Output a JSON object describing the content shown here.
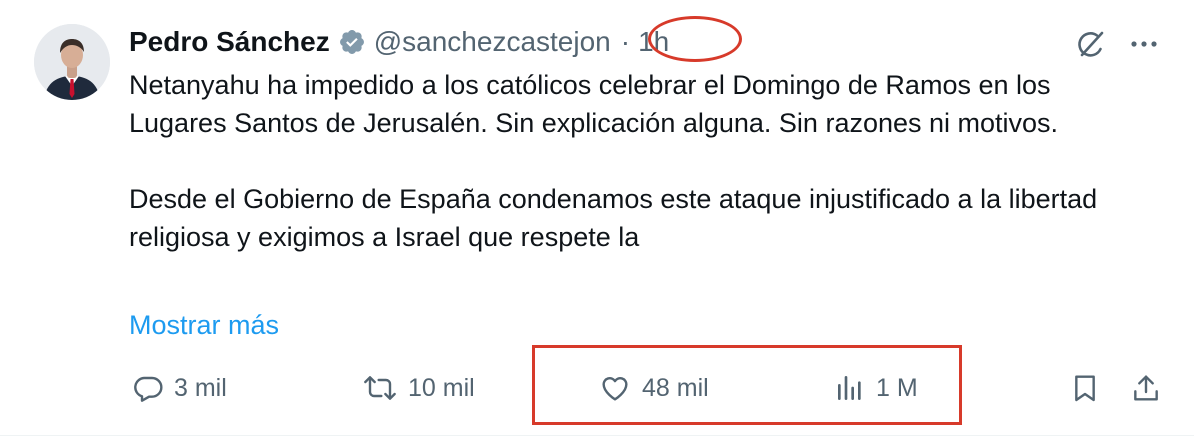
{
  "author": {
    "name": "Pedro Sánchez",
    "handle": "@sanchezcastejon",
    "separator": "·",
    "time": "1h"
  },
  "post": {
    "paragraphs": [
      "Netanyahu ha impedido a los católicos celebrar el Domingo de Ramos en los Lugares Santos de Jerusalén. Sin explicación alguna. Sin razones ni motivos.",
      "Desde el Gobierno de España condenamos este ataque injustificado a la libertad religiosa y exigimos a Israel que respete la"
    ],
    "show_more_label": "Mostrar más"
  },
  "actions": {
    "replies": "3 mil",
    "reposts": "10 mil",
    "likes": "48 mil",
    "views": "1 M"
  },
  "icons": {
    "verified": "verified-badge-icon",
    "grok": "grok-icon",
    "more": "more-icon",
    "reply": "reply-icon",
    "repost": "repost-icon",
    "like": "heart-icon",
    "views": "views-chart-icon",
    "bookmark": "bookmark-icon",
    "share": "share-icon"
  },
  "colors": {
    "text": "#0f1419",
    "secondary": "#536471",
    "link": "#1d9bf0",
    "annotation": "#d73a2a"
  }
}
